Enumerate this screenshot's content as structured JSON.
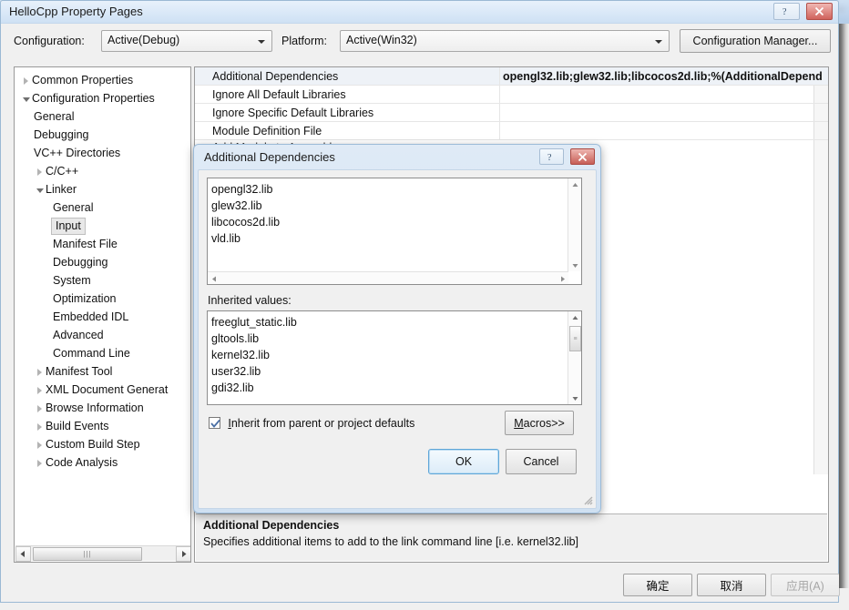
{
  "window": {
    "title": "HelloCpp Property Pages",
    "help_icon": "question-icon",
    "close_icon": "close-icon"
  },
  "config_bar": {
    "configuration_label": "Configuration:",
    "configuration_value": "Active(Debug)",
    "platform_label": "Platform:",
    "platform_value": "Active(Win32)",
    "configuration_manager_label": "Configuration Manager..."
  },
  "tree": {
    "items": [
      {
        "label": "Common Properties",
        "indent": 0,
        "twisty": "collapsed",
        "selected": false
      },
      {
        "label": "Configuration Properties",
        "indent": 0,
        "twisty": "expanded",
        "selected": false
      },
      {
        "label": "General",
        "indent": 1,
        "twisty": "none",
        "selected": false
      },
      {
        "label": "Debugging",
        "indent": 1,
        "twisty": "none",
        "selected": false
      },
      {
        "label": "VC++ Directories",
        "indent": 1,
        "twisty": "none",
        "selected": false
      },
      {
        "label": "C/C++",
        "indent": 1,
        "twisty": "collapsed",
        "selected": false
      },
      {
        "label": "Linker",
        "indent": 1,
        "twisty": "expanded",
        "selected": false
      },
      {
        "label": "General",
        "indent": 2,
        "twisty": "none",
        "selected": false
      },
      {
        "label": "Input",
        "indent": 2,
        "twisty": "none",
        "selected": true
      },
      {
        "label": "Manifest File",
        "indent": 2,
        "twisty": "none",
        "selected": false
      },
      {
        "label": "Debugging",
        "indent": 2,
        "twisty": "none",
        "selected": false
      },
      {
        "label": "System",
        "indent": 2,
        "twisty": "none",
        "selected": false
      },
      {
        "label": "Optimization",
        "indent": 2,
        "twisty": "none",
        "selected": false
      },
      {
        "label": "Embedded IDL",
        "indent": 2,
        "twisty": "none",
        "selected": false
      },
      {
        "label": "Advanced",
        "indent": 2,
        "twisty": "none",
        "selected": false
      },
      {
        "label": "Command Line",
        "indent": 2,
        "twisty": "none",
        "selected": false
      },
      {
        "label": "Manifest Tool",
        "indent": 1,
        "twisty": "collapsed",
        "selected": false
      },
      {
        "label": "XML Document Generat",
        "indent": 1,
        "twisty": "collapsed",
        "selected": false
      },
      {
        "label": "Browse Information",
        "indent": 1,
        "twisty": "collapsed",
        "selected": false
      },
      {
        "label": "Build Events",
        "indent": 1,
        "twisty": "collapsed",
        "selected": false
      },
      {
        "label": "Custom Build Step",
        "indent": 1,
        "twisty": "collapsed",
        "selected": false
      },
      {
        "label": "Code Analysis",
        "indent": 1,
        "twisty": "collapsed",
        "selected": false
      }
    ]
  },
  "property_grid": {
    "rows": [
      {
        "name": "Additional Dependencies",
        "value": "opengl32.lib;glew32.lib;libcocos2d.lib;%(AdditionalDepend",
        "selected": true
      },
      {
        "name": "Ignore All Default Libraries",
        "value": "",
        "selected": false
      },
      {
        "name": "Ignore Specific Default Libraries",
        "value": "",
        "selected": false
      },
      {
        "name": "Module Definition File",
        "value": "",
        "selected": false
      }
    ],
    "hidden_row_label": "Add Module to Assembly"
  },
  "description": {
    "title": "Additional Dependencies",
    "text": "Specifies additional items to add to the link command line [i.e. kernel32.lib]"
  },
  "footer": {
    "ok_label": "确定",
    "cancel_label": "取消",
    "apply_label": "应用(A)",
    "apply_disabled": true
  },
  "dialog": {
    "title": "Additional Dependencies",
    "help_icon": "question-icon",
    "close_icon": "close-icon",
    "dependencies": [
      "opengl32.lib",
      "glew32.lib",
      "libcocos2d.lib",
      "vld.lib"
    ],
    "inherited_label": "Inherited values:",
    "inherited_values": [
      "freeglut_static.lib",
      "gltools.lib",
      "kernel32.lib",
      "user32.lib",
      "gdi32.lib"
    ],
    "inherit_checkbox": {
      "checked": true,
      "accel": "I",
      "label_rest": "nherit from parent or project defaults"
    },
    "macros_button": {
      "accel": "M",
      "label_rest": "acros>>"
    },
    "ok_label": "OK",
    "cancel_label": "Cancel",
    "resize_grip_icon": "resize-grip-icon"
  },
  "colors": {
    "accent_blue": "#5fa6d8",
    "title_blue": "#cfe1f4",
    "close_red": "#c75f57",
    "disabled_gray": "#a6a6a6"
  }
}
